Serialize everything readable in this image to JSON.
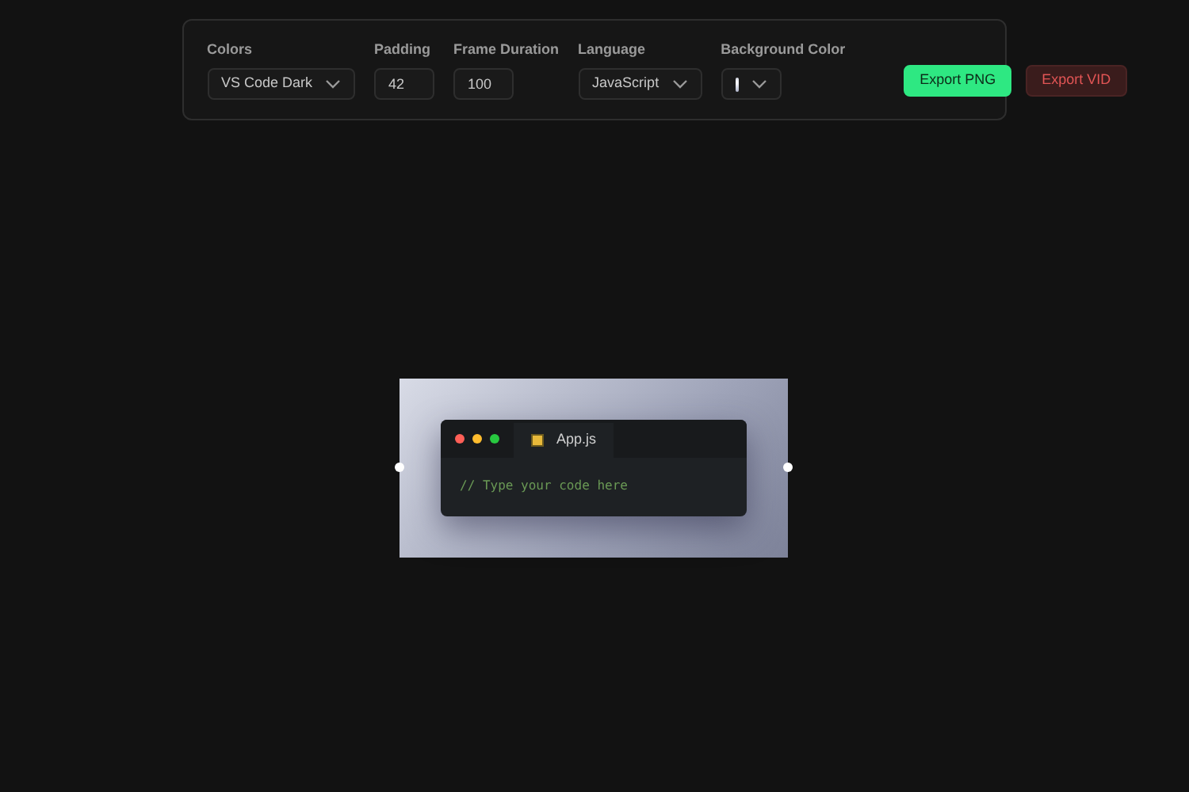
{
  "toolbar": {
    "controls": [
      {
        "kind": "select",
        "label": "Colors",
        "value": "VS Code Dark"
      },
      {
        "kind": "input",
        "label": "Padding",
        "value": "42"
      },
      {
        "kind": "input",
        "label": "Frame Duration",
        "value": "100"
      },
      {
        "kind": "select",
        "label": "Language",
        "value": "JavaScript"
      },
      {
        "kind": "color",
        "label": "Background Color"
      }
    ],
    "buttons": [
      {
        "label": "Export PNG",
        "kind": "primary"
      },
      {
        "label": "Export VID",
        "kind": "danger"
      }
    ]
  },
  "editor": {
    "tab": "App.js",
    "code": "// Type your code here"
  }
}
